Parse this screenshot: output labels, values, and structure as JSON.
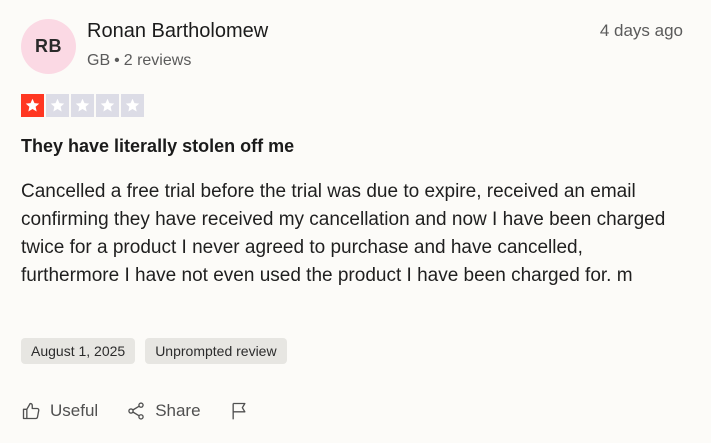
{
  "review": {
    "avatar_initials": "RB",
    "reviewer_name": "Ronan Bartholomew",
    "country": "GB",
    "review_count": "2 reviews",
    "posted": "4 days ago",
    "rating": 1,
    "max_rating": 5,
    "title": "They have literally stolen off me",
    "body": "Cancelled a free trial before the trial was due to expire, received an email confirming they have received my cancellation and now I have been charged twice for a product I never agreed to purchase and have cancelled, furthermore I have not even used the product I have been charged for. m",
    "date_of_experience": "August 1, 2025",
    "review_type": "Unprompted review"
  },
  "actions": {
    "useful_label": "Useful",
    "share_label": "Share"
  },
  "icons": {
    "useful": "thumbs-up-icon",
    "share": "share-icon",
    "report": "flag-icon"
  },
  "colors": {
    "star_active": "#ff3722",
    "star_inactive": "#dcdce6",
    "avatar_bg": "#fbd9e4"
  }
}
